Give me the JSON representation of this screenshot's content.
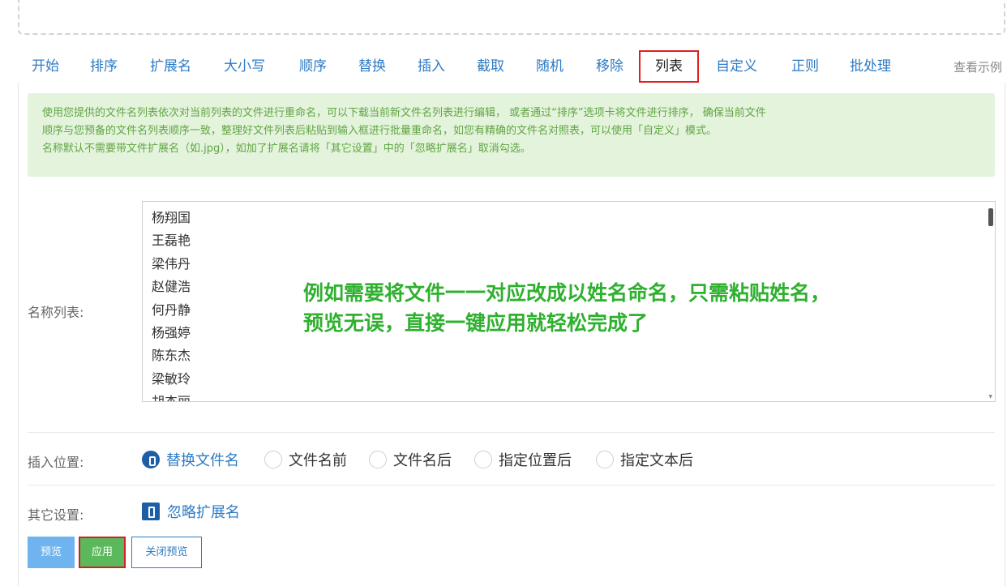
{
  "tabs": [
    {
      "label": "开始"
    },
    {
      "label": "排序"
    },
    {
      "label": "扩展名"
    },
    {
      "label": "大小写"
    },
    {
      "label": "顺序"
    },
    {
      "label": "替换"
    },
    {
      "label": "插入"
    },
    {
      "label": "截取"
    },
    {
      "label": "随机"
    },
    {
      "label": "移除"
    },
    {
      "label": "列表",
      "active": true
    },
    {
      "label": "自定义"
    },
    {
      "label": "正则"
    },
    {
      "label": "批处理"
    }
  ],
  "example_link": "查看示例",
  "info": {
    "line1": "使用您提供的文件名列表依次对当前列表的文件进行重命名，可以下载当前新文件名列表进行编辑， 或者通过“排序”选项卡将文件进行排序， 确保当前文件",
    "line2": "顺序与您预备的文件名列表顺序一致，整理好文件列表后粘贴到输入框进行批量重命名，如您有精确的文件名对照表，可以使用「自定义」模式。",
    "line3": "名称默认不需要带文件扩展名（如.jpg），如加了扩展名请将「其它设置」中的「忽略扩展名」取消勾选。"
  },
  "name_list": {
    "label": "名称列表:",
    "names": [
      "杨翔国",
      "王磊艳",
      "梁伟丹",
      "赵健浩",
      "何丹静",
      "杨强婷",
      "陈东杰",
      "梁敏玲",
      "胡杰丽"
    ]
  },
  "overlay": {
    "line1": "例如需要将文件一一对应改成以姓名命名，只需粘贴姓名，",
    "line2": "预览无误，直接一键应用就轻松完成了"
  },
  "insert_position": {
    "label": "插入位置:",
    "options": [
      {
        "label": "替换文件名",
        "checked": true
      },
      {
        "label": "文件名前",
        "checked": false
      },
      {
        "label": "文件名后",
        "checked": false
      },
      {
        "label": "指定位置后",
        "checked": false
      },
      {
        "label": "指定文本后",
        "checked": false
      }
    ]
  },
  "other_settings": {
    "label": "其它设置:",
    "ignore_ext_label": "忽略扩展名",
    "ignore_ext_checked": true
  },
  "buttons": {
    "preview": "预览",
    "apply": "应用",
    "close_preview": "关闭预览"
  },
  "colors": {
    "accent": "#2d7bc4",
    "info_bg": "#e3f3dc",
    "info_text": "#62a543",
    "overlay_text": "#2fb02f",
    "highlight_border": "#e02020"
  }
}
